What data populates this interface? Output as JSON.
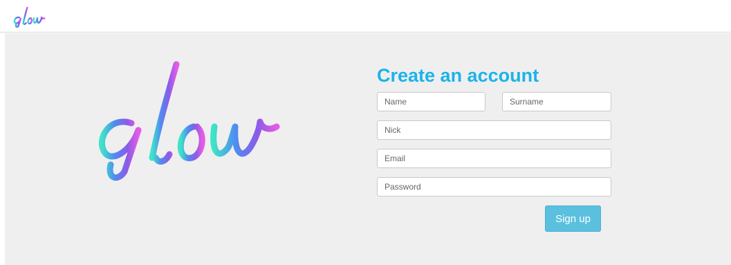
{
  "header": {
    "logo_icon": "glow-logo-icon"
  },
  "hero": {
    "logo_icon": "glow-logo-icon"
  },
  "form": {
    "title": "Create an account",
    "name_placeholder": "Name",
    "surname_placeholder": "Surname",
    "nick_placeholder": "Nick",
    "email_placeholder": "Email",
    "password_placeholder": "Password",
    "signup_label": "Sign up"
  },
  "colors": {
    "title": "#1cb3e8",
    "button": "#5bc0de",
    "panel": "#efefef",
    "logo_gradient": [
      "#3fe3c8",
      "#4f8cf0",
      "#8b5be8",
      "#e45be6"
    ]
  }
}
